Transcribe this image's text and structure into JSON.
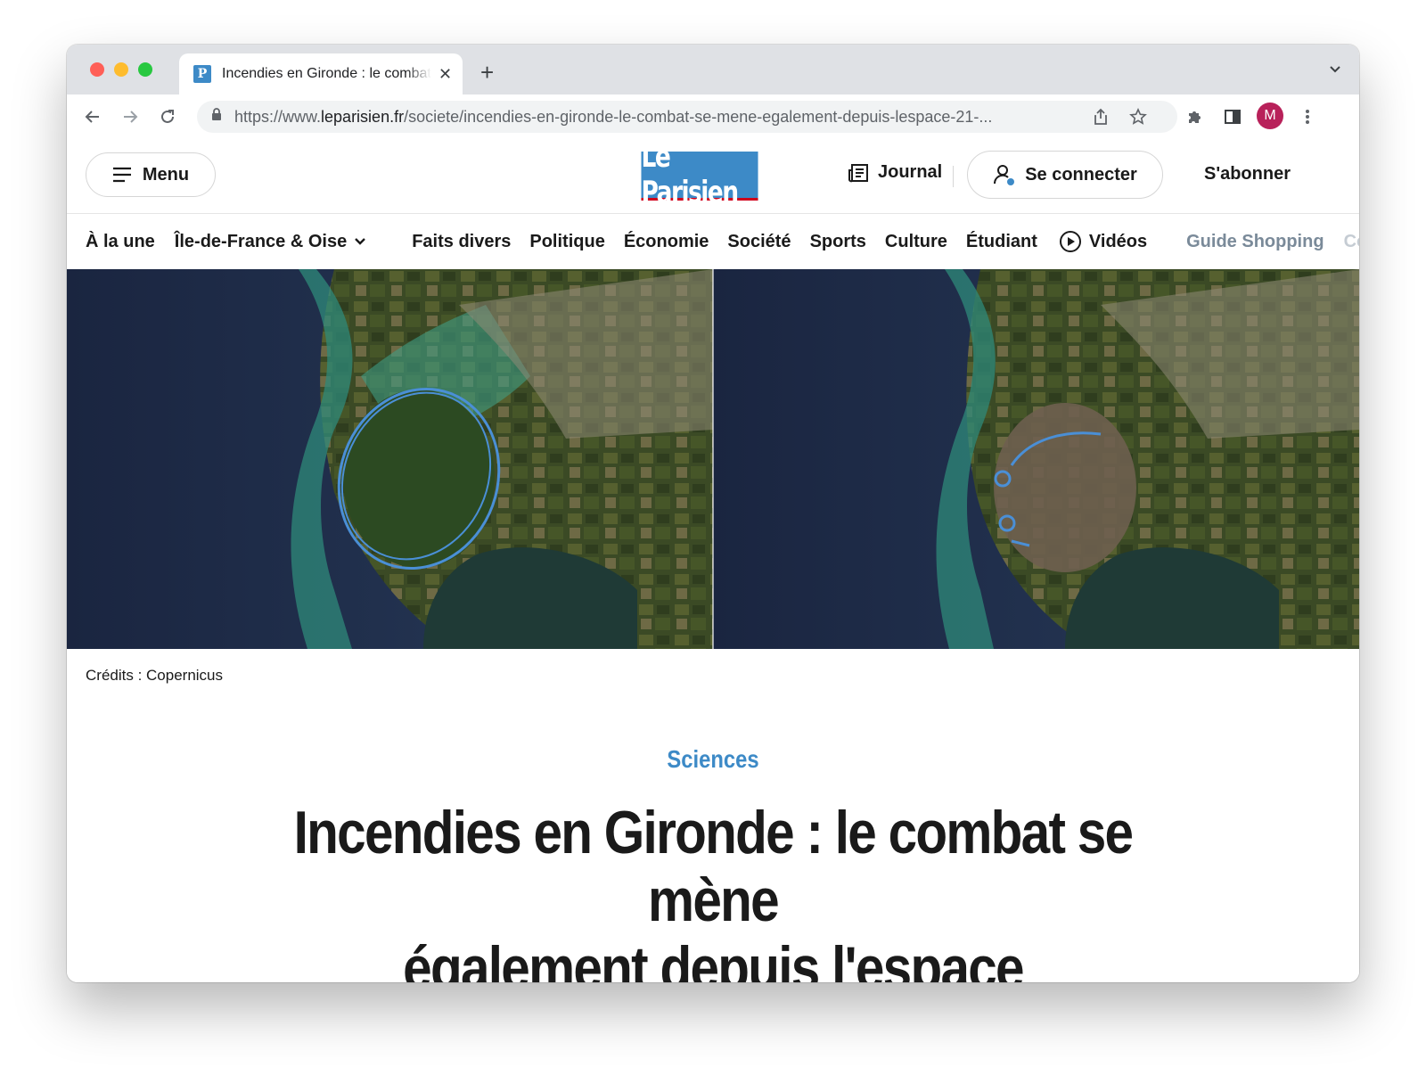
{
  "browser": {
    "tab_title": "Incendies en Gironde : le combat se mène également depuis l'espace",
    "favicon_letter": "P",
    "url_prefix": "https://www.",
    "url_domain": "leparisien.fr",
    "url_path": "/societe/incendies-en-gironde-le-combat-se-mene-egalement-depuis-lespace-21-...",
    "profile_initial": "M",
    "colors": {
      "close": "#ff5f57",
      "minimize": "#febc2e",
      "zoom": "#28c840"
    }
  },
  "header": {
    "menu_label": "Menu",
    "logo_text": "Le Parisien",
    "journal_label": "Journal",
    "connect_label": "Se connecter",
    "subscribe_label": "S'abonner"
  },
  "nav": {
    "items": [
      "À la une",
      "Île-de-France & Oise",
      "Faits divers",
      "Politique",
      "Économie",
      "Société",
      "Sports",
      "Culture",
      "Étudiant",
      "Vidéos",
      "Guide Shopping",
      "Code"
    ]
  },
  "article": {
    "image_credits": "Crédits : Copernicus",
    "section": "Sciences",
    "headline_line1": "Incendies en Gironde : le combat se mène",
    "headline_line2": "également depuis l'espace"
  },
  "colors": {
    "brand_blue": "#3d8ac7",
    "brand_red": "#d0021b"
  }
}
